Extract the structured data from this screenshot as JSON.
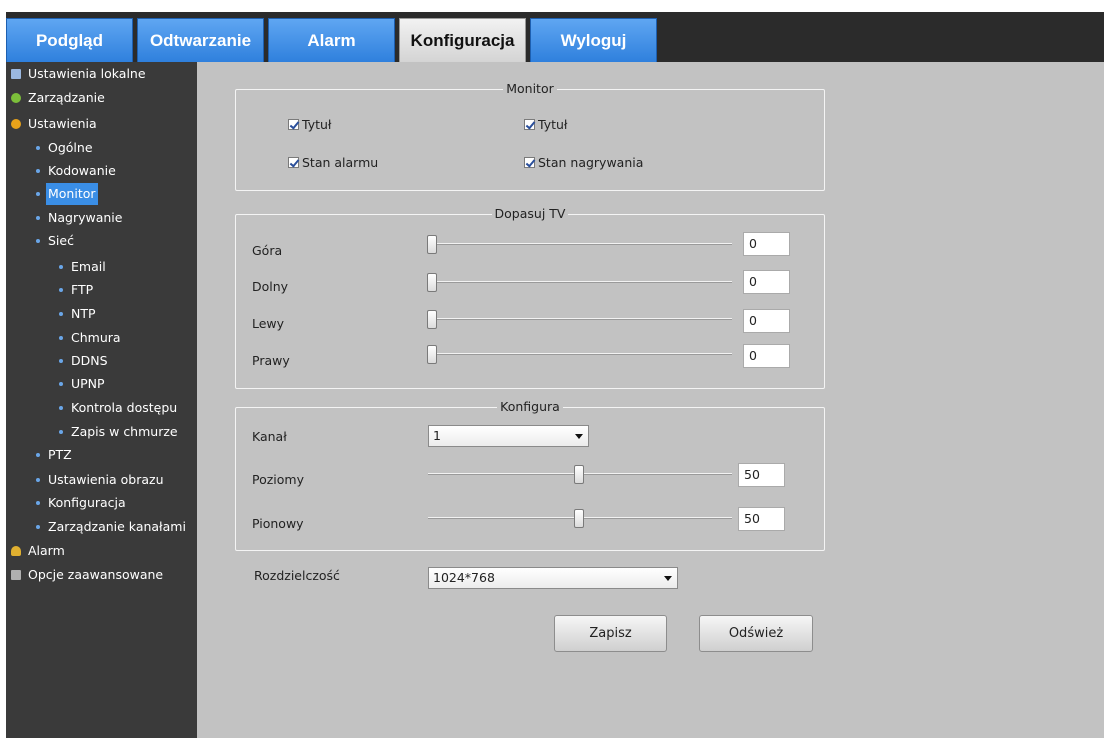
{
  "tabs": [
    {
      "label": "Podgląd",
      "active": false
    },
    {
      "label": "Odtwarzanie",
      "active": false
    },
    {
      "label": "Alarm",
      "active": false
    },
    {
      "label": "Konfiguracja",
      "active": true
    },
    {
      "label": "Wyloguj",
      "active": false
    }
  ],
  "sidebar": {
    "items": [
      {
        "label": "Ustawienia lokalne",
        "icon": "local-settings-icon"
      },
      {
        "label": "Zarządzanie",
        "icon": "management-icon"
      },
      {
        "label": "Ustawienia",
        "icon": "settings-gear-icon"
      },
      {
        "label": "Ogólne"
      },
      {
        "label": "Kodowanie"
      },
      {
        "label": "Monitor",
        "selected": true
      },
      {
        "label": "Nagrywanie"
      },
      {
        "label": "Sieć"
      },
      {
        "label": "Email"
      },
      {
        "label": "FTP"
      },
      {
        "label": "NTP"
      },
      {
        "label": "Chmura"
      },
      {
        "label": "DDNS"
      },
      {
        "label": "UPNP"
      },
      {
        "label": "Kontrola dostępu"
      },
      {
        "label": "Zapis w chmurze"
      },
      {
        "label": "PTZ"
      },
      {
        "label": "Ustawienia obrazu"
      },
      {
        "label": "Konfiguracja"
      },
      {
        "label": "Zarządzanie kanałami"
      },
      {
        "label": "Alarm",
        "icon": "alarm-bell-icon"
      },
      {
        "label": "Opcje zaawansowane",
        "icon": "advanced-tools-icon"
      }
    ]
  },
  "monitor": {
    "title": "Monitor",
    "checks": [
      {
        "label": "Tytuł",
        "checked": true
      },
      {
        "label": "Tytuł",
        "checked": true
      },
      {
        "label": "Stan alarmu",
        "checked": true
      },
      {
        "label": "Stan nagrywania",
        "checked": true
      }
    ]
  },
  "tv": {
    "title": "Dopasuj TV",
    "rows": [
      {
        "label": "Góra",
        "value": "0"
      },
      {
        "label": "Dolny",
        "value": "0"
      },
      {
        "label": "Lewy",
        "value": "0"
      },
      {
        "label": "Prawy",
        "value": "0"
      }
    ]
  },
  "config": {
    "title": "Konfigura",
    "channel_label": "Kanał",
    "channel_value": "1",
    "horizontal_label": "Poziomy",
    "horizontal_value": "50",
    "vertical_label": "Pionowy",
    "vertical_value": "50"
  },
  "resolution": {
    "label": "Rozdzielczość",
    "value": "1024*768"
  },
  "buttons": {
    "save": "Zapisz",
    "refresh": "Odśwież"
  },
  "colors": {
    "tab_blue": "#2f80dd",
    "sidebar_bg": "#3a3a3a",
    "selection": "#3a8ee6",
    "content_bg": "#c2c2c2"
  }
}
